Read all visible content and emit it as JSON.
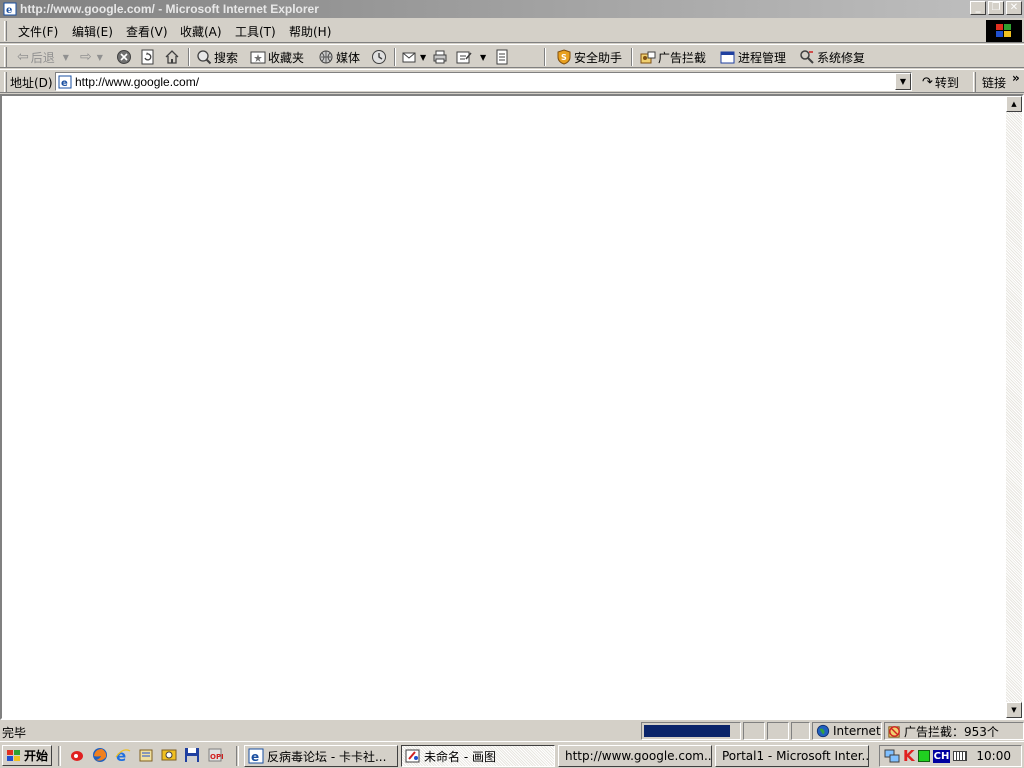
{
  "window": {
    "title": "http://www.google.com/ - Microsoft Internet Explorer"
  },
  "menu": [
    "文件(F)",
    "编辑(E)",
    "查看(V)",
    "收藏(A)",
    "工具(T)",
    "帮助(H)"
  ],
  "toolbar": {
    "back": "后退",
    "search": "搜索",
    "favorites": "收藏夹",
    "media": "媒体",
    "security": "安全助手",
    "adblock": "广告拦截",
    "process": "进程管理",
    "repair": "系统修复"
  },
  "address": {
    "label": "地址(D)",
    "url": "http://www.google.com/",
    "go": "转到",
    "links": "链接"
  },
  "status": {
    "text": "完毕",
    "zone": "Internet",
    "adblock": "广告拦截：953个",
    "progress": 0.9
  },
  "taskbar": {
    "start": "开始",
    "tasks": [
      "反病毒论坛 - 卡卡社...",
      "未命名 - 画图",
      "http://www.google.com...",
      "Portal1 - Microsoft Inter..."
    ],
    "tray": {
      "lang": "CH",
      "clock": "10:00"
    }
  },
  "colors": {
    "title_start": "#808080",
    "progress": "#0a246a",
    "tray_lang_bg": "#0000a0"
  }
}
